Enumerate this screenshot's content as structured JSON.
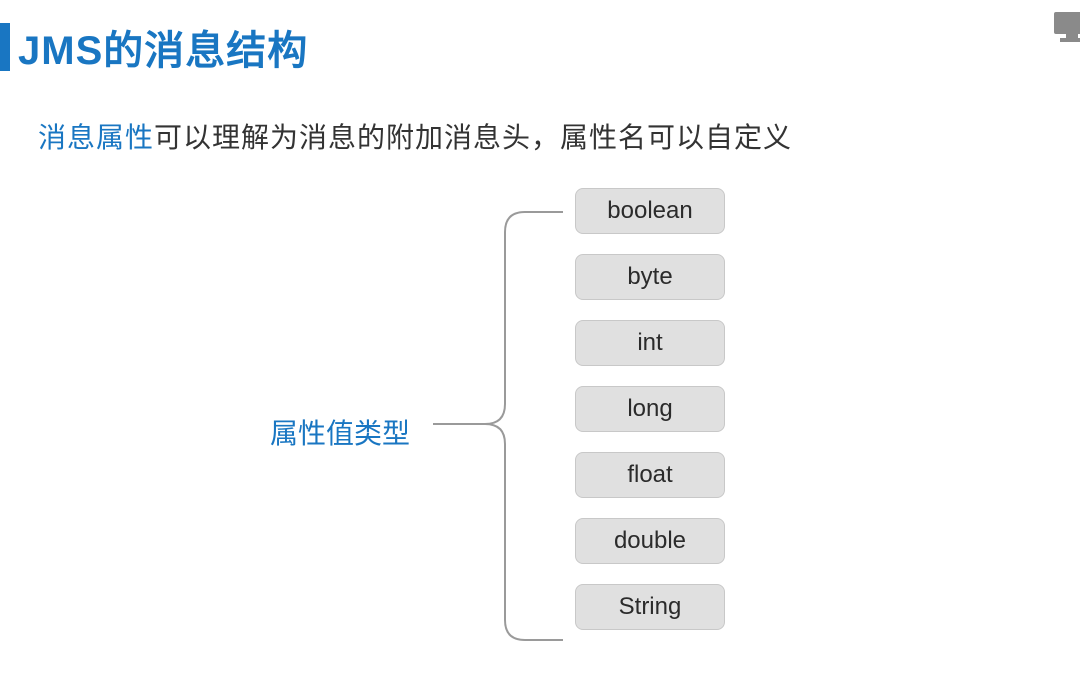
{
  "title": "JMS的消息结构",
  "subtitle": {
    "highlight": "消息属性",
    "rest": "可以理解为消息的附加消息头，属性名可以自定义"
  },
  "centerLabel": "属性值类型",
  "types": [
    "boolean",
    "byte",
    "int",
    "long",
    "float",
    "double",
    "String"
  ],
  "colors": {
    "accent": "#1976C2",
    "box_bg": "#E0E0E0",
    "box_border": "#C8C8C8"
  }
}
